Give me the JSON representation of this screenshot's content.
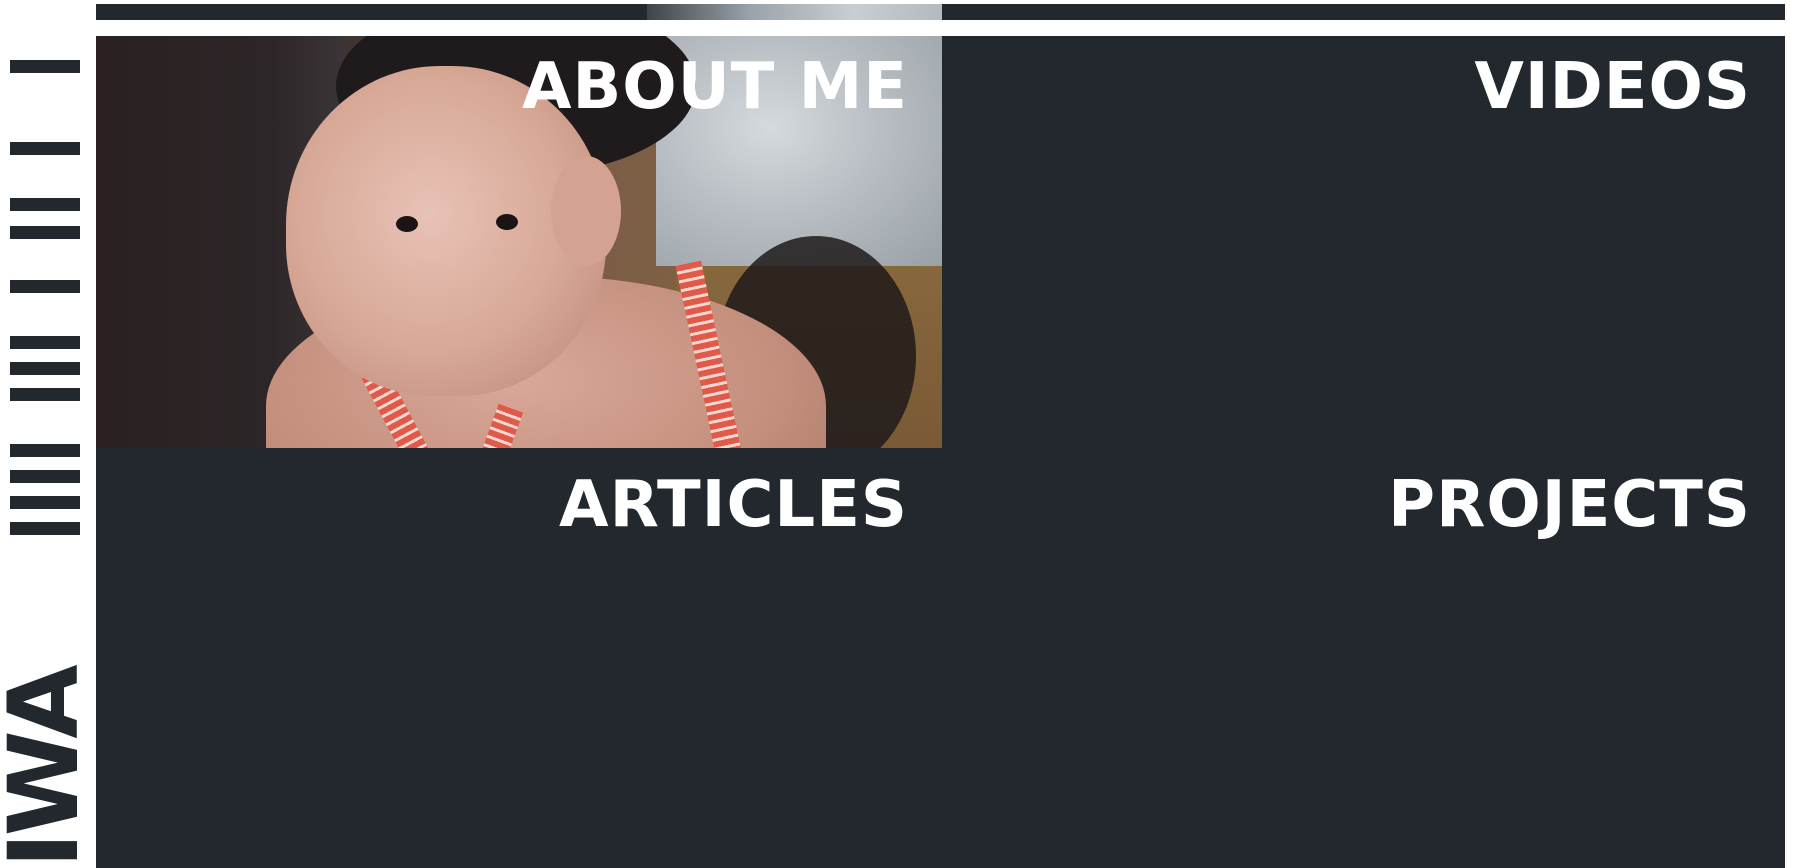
{
  "brand": {
    "wordmark": "IWA"
  },
  "tiles": [
    {
      "label": "ABOUT ME"
    },
    {
      "label": "VIDEOS"
    },
    {
      "label": "ARTICLES"
    },
    {
      "label": "PROJECTS"
    }
  ],
  "colors": {
    "tile_background": "#22282d",
    "page_background": "#ffffff",
    "label_text": "#ffffff"
  }
}
